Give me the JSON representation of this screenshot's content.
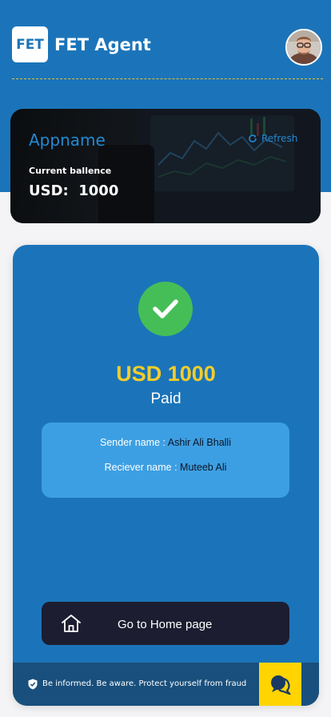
{
  "header": {
    "logo_text": "FET",
    "title": "FET Agent",
    "avatar_icon": "user-avatar"
  },
  "balance_card": {
    "app_name": "Appname",
    "refresh_label": "Refresh",
    "refresh_icon": "refresh-icon",
    "balance_label": "Current ballence",
    "balance_value": "USD:  1000"
  },
  "receipt": {
    "status_icon": "check-icon",
    "amount": "USD 1000",
    "status": "Paid",
    "sender_label": "Sender name : ",
    "sender_value": "Ashir Ali Bhalli",
    "receiver_label": "Reciever name : ",
    "receiver_value": "Muteeb Ali",
    "home_button_label": "Go to Home page",
    "home_icon": "home-icon"
  },
  "footer": {
    "notice": "Be informed. Be aware. Protect yourself from fraud",
    "shield_icon": "shield-icon",
    "chat_icon": "chat-icon"
  },
  "colors": {
    "primary": "#1b74b9",
    "accent_yellow": "#f4cd2a",
    "success_green": "#46be57",
    "dark_button": "#1c1d30",
    "footer_bg": "#194f7c"
  }
}
